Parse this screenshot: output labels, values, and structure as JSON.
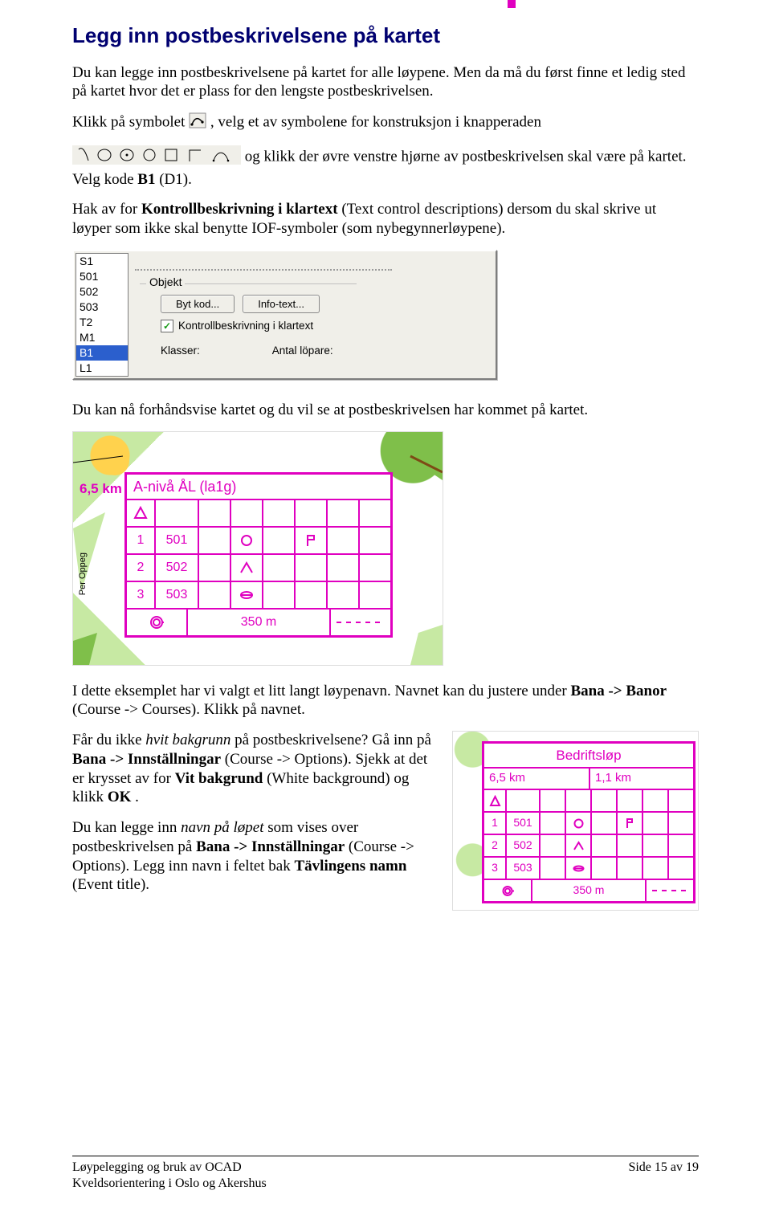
{
  "heading": "Legg inn postbeskrivelsene på kartet",
  "para1": "Du kan legge inn postbeskrivelsene på kartet for alle løypene. Men da må du først finne et ledig sted på kartet hvor det er plass for den lengste postbeskrivelsen.",
  "para2a": "Klikk på symbolet ",
  "para2b": ", velg et av symbolene for konstruksjon i knapperaden",
  "para3a": " og klikk der øvre venstre hjørne av postbeskrivelsen skal være på kartet. Velg kode ",
  "para3b": "B1",
  "para3c": " (D1).",
  "para4a": "Hak av for ",
  "para4b": "Kontrollbeskrivning i klartext",
  "para4c": " (Text control descriptions) dersom du skal skrive ut løyper som ikke skal benytte IOF-symboler (som nybegynnerløypene).",
  "fig1": {
    "list": [
      "S1",
      "501",
      "502",
      "503",
      "T2",
      "M1",
      "B1",
      "L1"
    ],
    "selected": "B1",
    "group_label": "Objekt",
    "btn_bytkod": "Byt kod...",
    "btn_infotext": "Info-text...",
    "chk_label": "Kontrollbeskrivning i klartext",
    "klasser": "Klasser:",
    "antal": "Antal löpare:"
  },
  "para5": "Du kan nå forhåndsvise kartet og du vil se at postbeskrivelsen har kommet på kartet.",
  "fig2": {
    "dist": "6,5 km",
    "hdr": "A-nivå ÅL (la1g)",
    "rows": [
      {
        "n": "1",
        "code": "501",
        "colD": "circle"
      },
      {
        "n": "2",
        "code": "502",
        "colD": "knoll"
      },
      {
        "n": "3",
        "code": "503",
        "colD": "marsh"
      }
    ],
    "triangle_row": true,
    "footer_dist": "350 m",
    "sidecap": "Per Oppeg"
  },
  "para6a": "I dette eksemplet har vi valgt et litt langt løypenavn. Navnet kan du justere under ",
  "para6b": "Bana -> Banor",
  "para6c": " (Course -> Courses). Klikk på navnet.",
  "fig3": {
    "title": "Bedriftsløp",
    "km_a": "6,5 km",
    "km_b": "1,1 km",
    "rows": [
      {
        "n": "1",
        "code": "501",
        "colD": "circle"
      },
      {
        "n": "2",
        "code": "502",
        "colD": "knoll"
      },
      {
        "n": "3",
        "code": "503",
        "colD": "marsh"
      }
    ],
    "footer_dist": "350 m"
  },
  "para7a": "Får du ikke ",
  "para7b": "hvit bakgrunn",
  "para7c": " på postbeskrivelsene? Gå inn på ",
  "para7d": "Bana -> Innställningar",
  "para7e": " (Course -> Options). Sjekk at det er krysset av for ",
  "para7f": "Vit bakgrund",
  "para7g": " (White background) og klikk ",
  "para7h": "OK",
  "para7i": ".",
  "para8a": "Du kan legge inn ",
  "para8b": "navn på løpet",
  "para8c": " som vises over postbeskrivelsen på ",
  "para8d": "Bana -> Innställningar",
  "para8e": " (Course -> Options). Legg inn navn i feltet bak ",
  "para8f": "Tävlingens namn",
  "para8g": " (Event title).",
  "footer": {
    "left1": "Løypelegging og bruk av OCAD",
    "left2": "Kveldsorientering i Oslo og Akershus",
    "right": "Side 15 av 19"
  }
}
